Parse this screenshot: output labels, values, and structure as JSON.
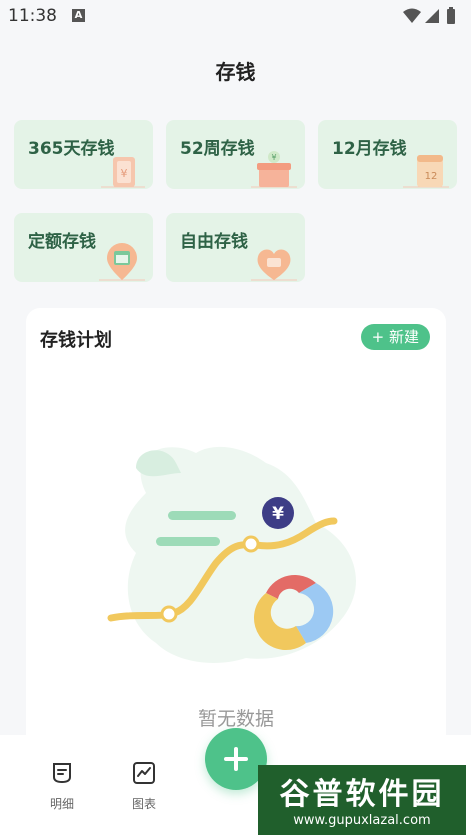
{
  "status_bar": {
    "time": "11:38",
    "badge": "A"
  },
  "header": {
    "title": "存钱"
  },
  "cards": [
    {
      "label": "365天存钱",
      "icon": "bill-icon"
    },
    {
      "label": "52周存钱",
      "icon": "gift-box-icon"
    },
    {
      "label": "12月存钱",
      "icon": "calendar-12-icon"
    },
    {
      "label": "定额存钱",
      "icon": "calendar-pin-icon"
    },
    {
      "label": "自由存钱",
      "icon": "heart-pin-icon"
    }
  ],
  "plan": {
    "title": "存钱计划",
    "new_button": "+ 新建",
    "empty_text": "暂无数据"
  },
  "tabbar": {
    "items": [
      {
        "label": "明细",
        "icon": "list-doc-icon"
      },
      {
        "label": "图表",
        "icon": "chart-icon"
      }
    ],
    "fab_icon": "plus-icon"
  },
  "watermark": {
    "text": "谷普软件园",
    "url": "www.gupuxlazal.com"
  },
  "colors": {
    "accent": "#4ec28a",
    "card_bg": "#e4f3e7",
    "card_text": "#2e6246"
  }
}
